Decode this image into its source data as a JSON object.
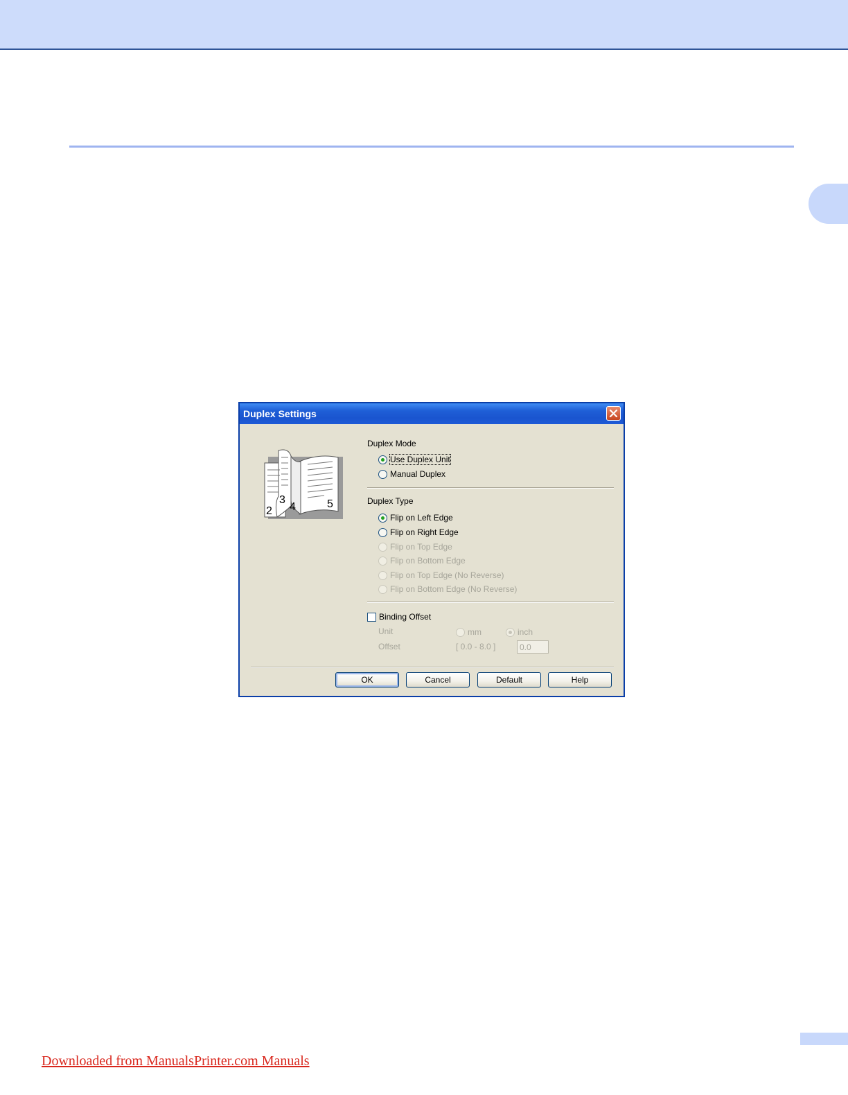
{
  "footer": {
    "link_text": "Downloaded from ManualsPrinter.com Manuals"
  },
  "dialog": {
    "title": "Duplex Settings",
    "preview_pages": [
      "2",
      "3",
      "4",
      "5"
    ],
    "duplex_mode": {
      "label": "Duplex Mode",
      "options": [
        {
          "label": "Use Duplex Unit",
          "selected": true
        },
        {
          "label": "Manual Duplex",
          "selected": false
        }
      ]
    },
    "duplex_type": {
      "label": "Duplex Type",
      "options": [
        {
          "label": "Flip on Left Edge",
          "selected": true,
          "enabled": true
        },
        {
          "label": "Flip on Right Edge",
          "selected": false,
          "enabled": true
        },
        {
          "label": "Flip on Top Edge",
          "selected": false,
          "enabled": false
        },
        {
          "label": "Flip on Bottom Edge",
          "selected": false,
          "enabled": false
        },
        {
          "label": "Flip on Top Edge (No Reverse)",
          "selected": false,
          "enabled": false
        },
        {
          "label": "Flip on Bottom Edge (No Reverse)",
          "selected": false,
          "enabled": false
        }
      ]
    },
    "binding_offset": {
      "label": "Binding Offset",
      "checked": false,
      "unit_label": "Unit",
      "unit_mm": "mm",
      "unit_inch": "inch",
      "unit_selected": "inch",
      "offset_label": "Offset",
      "offset_range": "[ 0.0 - 8.0 ]",
      "offset_value": "0.0"
    },
    "buttons": {
      "ok": "OK",
      "cancel": "Cancel",
      "default": "Default",
      "help": "Help"
    }
  },
  "colors": {
    "header_band": "#cddcfb",
    "rule": "#9fb4f0",
    "titlebar": "#1f5fd7",
    "dialog_bg": "#e4e1d2",
    "footer_link": "#d9261c"
  }
}
